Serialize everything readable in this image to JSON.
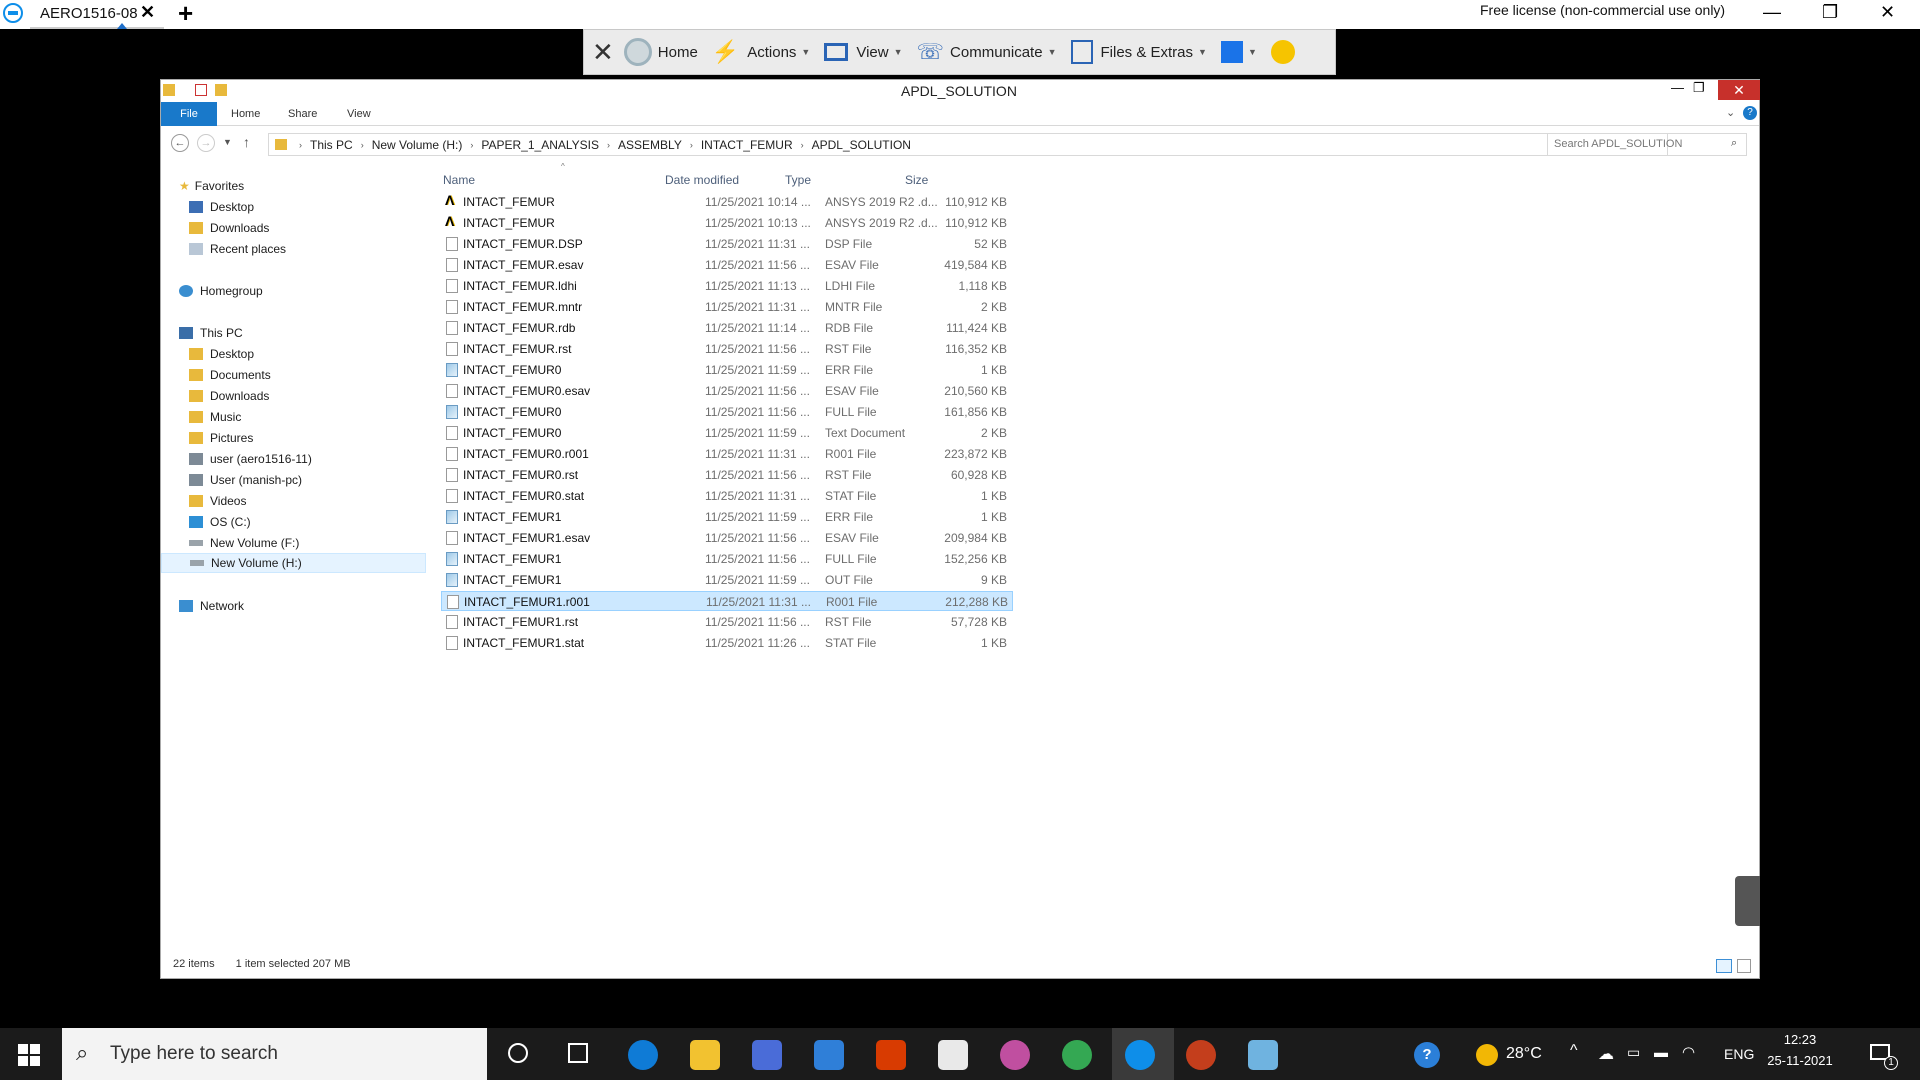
{
  "teamviewer": {
    "tab_label": "AERO1516-08",
    "license_text": "Free license (non-commercial use only)",
    "toolbar": {
      "home": "Home",
      "actions": "Actions",
      "view": "View",
      "communicate": "Communicate",
      "files_extras": "Files & Extras"
    }
  },
  "explorer": {
    "title": "APDL_SOLUTION",
    "ribbon": {
      "file": "File",
      "home": "Home",
      "share": "Share",
      "view": "View"
    },
    "breadcrumb": [
      "This PC",
      "New Volume (H:)",
      "PAPER_1_ANALYSIS",
      "ASSEMBLY",
      "INTACT_FEMUR",
      "APDL_SOLUTION"
    ],
    "search_placeholder": "Search APDL_SOLUTION",
    "sidebar": {
      "favorites": "Favorites",
      "fav_desktop": "Desktop",
      "fav_downloads": "Downloads",
      "fav_recent": "Recent places",
      "homegroup": "Homegroup",
      "this_pc": "This PC",
      "pc_desktop": "Desktop",
      "pc_documents": "Documents",
      "pc_downloads": "Downloads",
      "pc_music": "Music",
      "pc_pictures": "Pictures",
      "pc_user1": "user (aero1516-11)",
      "pc_user2": "User (manish-pc)",
      "pc_videos": "Videos",
      "pc_osc": "OS (C:)",
      "pc_volf": "New Volume (F:)",
      "pc_volh": "New Volume  (H:)",
      "network": "Network"
    },
    "columns": {
      "name": "Name",
      "date": "Date modified",
      "type": "Type",
      "size": "Size"
    },
    "files": [
      {
        "name": "INTACT_FEMUR",
        "date": "11/25/2021 10:14 ...",
        "type": "ANSYS 2019 R2 .d...",
        "size": "110,912 KB"
      },
      {
        "name": "INTACT_FEMUR",
        "date": "11/25/2021 10:13 ...",
        "type": "ANSYS 2019 R2 .d...",
        "size": "110,912 KB"
      },
      {
        "name": "INTACT_FEMUR.DSP",
        "date": "11/25/2021 11:31 ...",
        "type": "DSP File",
        "size": "52 KB"
      },
      {
        "name": "INTACT_FEMUR.esav",
        "date": "11/25/2021 11:56 ...",
        "type": "ESAV File",
        "size": "419,584 KB"
      },
      {
        "name": "INTACT_FEMUR.ldhi",
        "date": "11/25/2021 11:13 ...",
        "type": "LDHI File",
        "size": "1,118 KB"
      },
      {
        "name": "INTACT_FEMUR.mntr",
        "date": "11/25/2021 11:31 ...",
        "type": "MNTR File",
        "size": "2 KB"
      },
      {
        "name": "INTACT_FEMUR.rdb",
        "date": "11/25/2021 11:14 ...",
        "type": "RDB File",
        "size": "111,424 KB"
      },
      {
        "name": "INTACT_FEMUR.rst",
        "date": "11/25/2021 11:56 ...",
        "type": "RST File",
        "size": "116,352 KB"
      },
      {
        "name": "INTACT_FEMUR0",
        "date": "11/25/2021 11:59 ...",
        "type": "ERR File",
        "size": "1 KB"
      },
      {
        "name": "INTACT_FEMUR0.esav",
        "date": "11/25/2021 11:56 ...",
        "type": "ESAV File",
        "size": "210,560 KB"
      },
      {
        "name": "INTACT_FEMUR0",
        "date": "11/25/2021 11:56 ...",
        "type": "FULL File",
        "size": "161,856 KB"
      },
      {
        "name": "INTACT_FEMUR0",
        "date": "11/25/2021 11:59 ...",
        "type": "Text Document",
        "size": "2 KB"
      },
      {
        "name": "INTACT_FEMUR0.r001",
        "date": "11/25/2021 11:31 ...",
        "type": "R001 File",
        "size": "223,872 KB"
      },
      {
        "name": "INTACT_FEMUR0.rst",
        "date": "11/25/2021 11:56 ...",
        "type": "RST File",
        "size": "60,928 KB"
      },
      {
        "name": "INTACT_FEMUR0.stat",
        "date": "11/25/2021 11:31 ...",
        "type": "STAT File",
        "size": "1 KB"
      },
      {
        "name": "INTACT_FEMUR1",
        "date": "11/25/2021 11:59 ...",
        "type": "ERR File",
        "size": "1 KB"
      },
      {
        "name": "INTACT_FEMUR1.esav",
        "date": "11/25/2021 11:56 ...",
        "type": "ESAV File",
        "size": "209,984 KB"
      },
      {
        "name": "INTACT_FEMUR1",
        "date": "11/25/2021 11:56 ...",
        "type": "FULL File",
        "size": "152,256 KB"
      },
      {
        "name": "INTACT_FEMUR1",
        "date": "11/25/2021 11:59 ...",
        "type": "OUT File",
        "size": "9 KB"
      },
      {
        "name": "INTACT_FEMUR1.r001",
        "date": "11/25/2021 11:31 ...",
        "type": "R001 File",
        "size": "212,288 KB"
      },
      {
        "name": "INTACT_FEMUR1.rst",
        "date": "11/25/2021 11:56 ...",
        "type": "RST File",
        "size": "57,728 KB"
      },
      {
        "name": "INTACT_FEMUR1.stat",
        "date": "11/25/2021 11:26 ...",
        "type": "STAT File",
        "size": "1 KB"
      }
    ],
    "status": {
      "item_count": "22 items",
      "selection": "1 item selected  207 MB"
    }
  },
  "taskbar": {
    "search_placeholder": "Type here to search",
    "weather": "28°C",
    "language": "ENG",
    "time": "12:23",
    "date": "25-11-2021",
    "notification_count": "1"
  }
}
